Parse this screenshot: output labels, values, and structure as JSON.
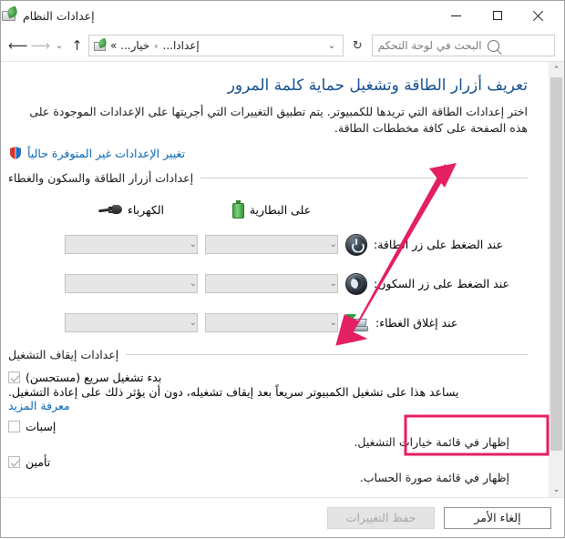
{
  "window": {
    "title": "إعدادات النظام",
    "app_icon": "system-settings-icon",
    "caption": {
      "minimize": "تصغير",
      "maximize": "تكبير",
      "close": "إغلاق"
    }
  },
  "navbar": {
    "back": "رجوع",
    "forward": "إلى الأمام",
    "recent": "المواقع الأخيرة",
    "up": "لأعلى",
    "refresh": "تحديث",
    "breadcrumb": {
      "items": [
        "إعدادا...",
        "خيار... »"
      ],
      "separator": "›"
    },
    "search": {
      "placeholder": "البحث في لوحة التحكم",
      "icon": "search-icon"
    }
  },
  "page": {
    "title": "تعريف أزرار الطاقة وتشغيل حماية كلمة المرور",
    "description": "اختر إعدادات الطاقة التي تريدها للكمبيوتر. يتم تطبيق التغييرات التي أجريتها على الإعدادات الموجودة على هذه الصفحة على كافة مخططات الطاقة.",
    "admin_link": "تغيير الإعدادات غير المتوفرة حالياً",
    "admin_link_icon": "shield-icon"
  },
  "power_section": {
    "heading": "إعدادات أزرار الطاقة والسكون والغطاء",
    "columns": [
      {
        "label": "على البطارية",
        "icon": "battery-icon"
      },
      {
        "label": "الكهرباء",
        "icon": "power-plug-icon"
      }
    ],
    "rows": [
      {
        "label": "عند الضغط على زر الطاقة:",
        "icon": "power-button-icon",
        "battery_value": "",
        "plugged_value": "",
        "chevron": "⌄"
      },
      {
        "label": "عند الضغط على زر السكون:",
        "icon": "sleep-button-icon",
        "battery_value": "",
        "plugged_value": "",
        "chevron": "⌄"
      },
      {
        "label": "عند إغلاق الغطاء:",
        "icon": "laptop-lid-icon",
        "battery_value": "",
        "plugged_value": "",
        "chevron": "⌄"
      }
    ]
  },
  "shutdown_section": {
    "heading": "إعدادات إيقاف التشغيل",
    "items": [
      {
        "label": "بدء تشغيل سريع (مستحسن)",
        "checked": true,
        "help_text": "يساعد هذا على تشغيل الكمبيوتر سريعاً بعد إيقاف تشغيله، دون أن يؤثر ذلك على إعادة التشغيل.",
        "help_link": "معرفة المزيد"
      },
      {
        "label": "إسبات",
        "checked": false,
        "help_text": "إظهار في قائمة خيارات التشغيل.",
        "help_link": ""
      },
      {
        "label": "تأمين",
        "checked": true,
        "help_text": "إظهار في قائمة صورة الحساب.",
        "help_link": ""
      }
    ]
  },
  "footer": {
    "save_label": "حفظ التغييرات",
    "save_enabled": false,
    "cancel_label": "إلغاء الأمر",
    "cancel_enabled": true
  },
  "annotations": {
    "arrow_color": "#e41f63",
    "highlight_color": "#e41f63",
    "highlight_target": "إسبات"
  },
  "scrollbar": {
    "up_arrow": "⌃",
    "down_arrow": "⌄"
  }
}
